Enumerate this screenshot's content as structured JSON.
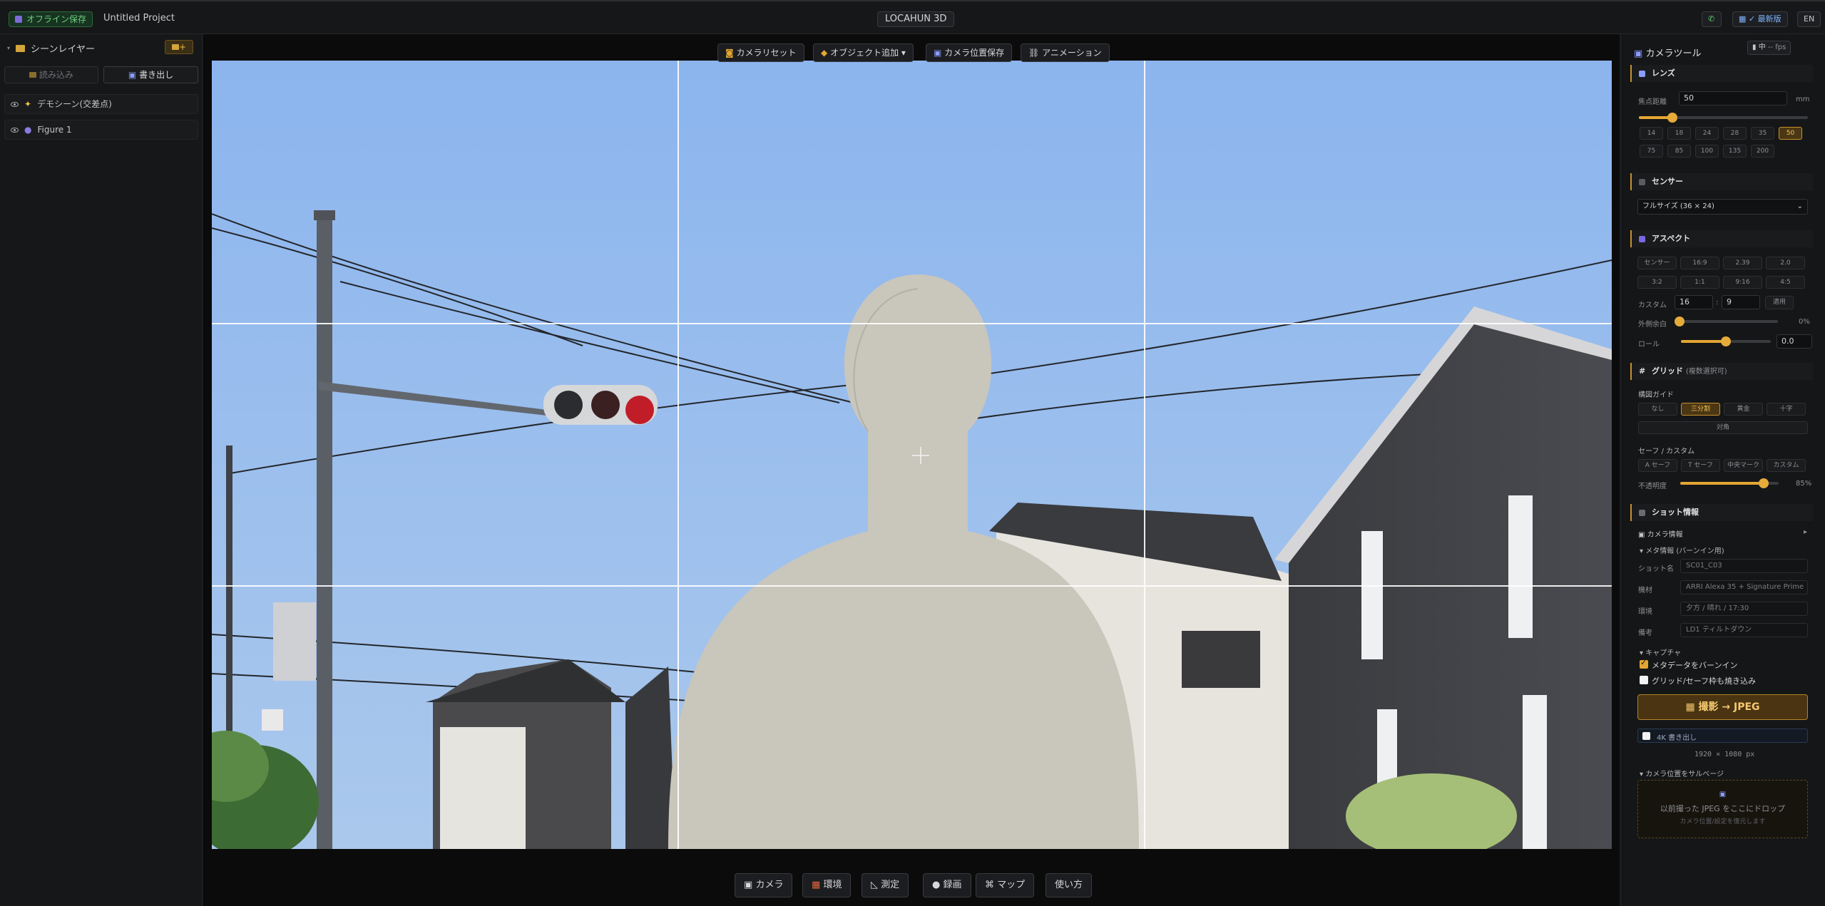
{
  "topbar": {
    "offline_label": "オフライン保存",
    "project_name": "Untitled Project",
    "app_name": "LOCAHUN 3D",
    "latest_label": "✓ 最新版",
    "lang_label": "EN"
  },
  "left": {
    "header": "シーンレイヤー",
    "add_label": "+",
    "load_label": "読み込み",
    "export_label": "書き出し",
    "layers": [
      {
        "name": "デモシーン(交差点)"
      },
      {
        "name": "Figure 1"
      }
    ]
  },
  "viewport_toolbar": {
    "camera_reset": "カメラリセット",
    "add_object": "オブジェクト追加 ▾",
    "save_camera": "カメラ位置保存",
    "animation": "アニメーション"
  },
  "bottom_toolbar": {
    "camera": "カメラ",
    "environment": "環境",
    "measure": "測定",
    "record": "録画",
    "map": "マップ",
    "help": "使い方"
  },
  "right": {
    "title": "カメラツール",
    "perf_mid": "中",
    "perf_fps": "-- fps",
    "lens": {
      "section": "レンズ",
      "focal_label": "焦点距離",
      "focal_value": "50",
      "focal_unit": "mm",
      "focal_fraction": 0.2,
      "presets": [
        "14",
        "18",
        "24",
        "28",
        "35",
        "50",
        "75",
        "85",
        "100",
        "135",
        "200"
      ],
      "active": "50"
    },
    "sensor": {
      "section": "センサー",
      "value": "フルサイズ (36 × 24)"
    },
    "aspect": {
      "section": "アスペクト",
      "options": [
        "センサー",
        "16:9",
        "2.39",
        "2.0",
        "3:2",
        "1:1",
        "9:16",
        "4:5"
      ],
      "custom_label": "カスタム",
      "custom_w": "16",
      "custom_sep": ":",
      "custom_h": "9",
      "apply": "適用",
      "margin_label": "外側余白",
      "margin_value": "0%",
      "margin_fraction": 0.0,
      "roll_label": "ロール",
      "roll_value": "0.0",
      "roll_fraction": 0.5
    },
    "grid": {
      "section": "グリッド",
      "note": "(複数選択可)",
      "guide_label": "構図ガイド",
      "guides": [
        "なし",
        "三分割",
        "黄金",
        "十字"
      ],
      "active": "三分割",
      "diagonal": "対角",
      "safe_label": "セーフ / カスタム",
      "safe_options": [
        "A セーフ",
        "T セーフ",
        "中央マーク",
        "カスタム"
      ],
      "opacity_label": "不透明度",
      "opacity_value": "85%",
      "opacity_fraction": 0.85
    },
    "shot": {
      "section": "ショット情報",
      "camera_info": "カメラ情報",
      "meta_header": "▾ メタ情報 (バーンイン用)",
      "fields": [
        {
          "label": "ショット名",
          "placeholder": "SC01_C03"
        },
        {
          "label": "機材",
          "placeholder": "ARRI Alexa 35 + Signature Prime"
        },
        {
          "label": "環境",
          "placeholder": "夕方 / 晴れ / 17:30"
        },
        {
          "label": "備考",
          "placeholder": "LD1 ティルトダウン"
        }
      ],
      "capture_header": "▾ キャプチャ",
      "burnin_label": "メタデータをバーンイン",
      "burnin_checked": true,
      "gridburn_label": "グリッド/セーフ枠も焼き込み",
      "gridburn_checked": false,
      "capture_button": "撮影 → JPEG",
      "export4k_label": "4K 書き出し",
      "resolution": "1920 × 1080 px",
      "salvage_header": "▾ カメラ位置をサルベージ",
      "drop_text": "以前撮った JPEG をここにドロップ",
      "drop_sub": "カメラ位置/設定を復元します"
    }
  },
  "colors": {
    "accent": "#e2a633",
    "sky": "#8fb6e9",
    "figure": "#c9c6bc",
    "offline": "#6fd07d"
  }
}
